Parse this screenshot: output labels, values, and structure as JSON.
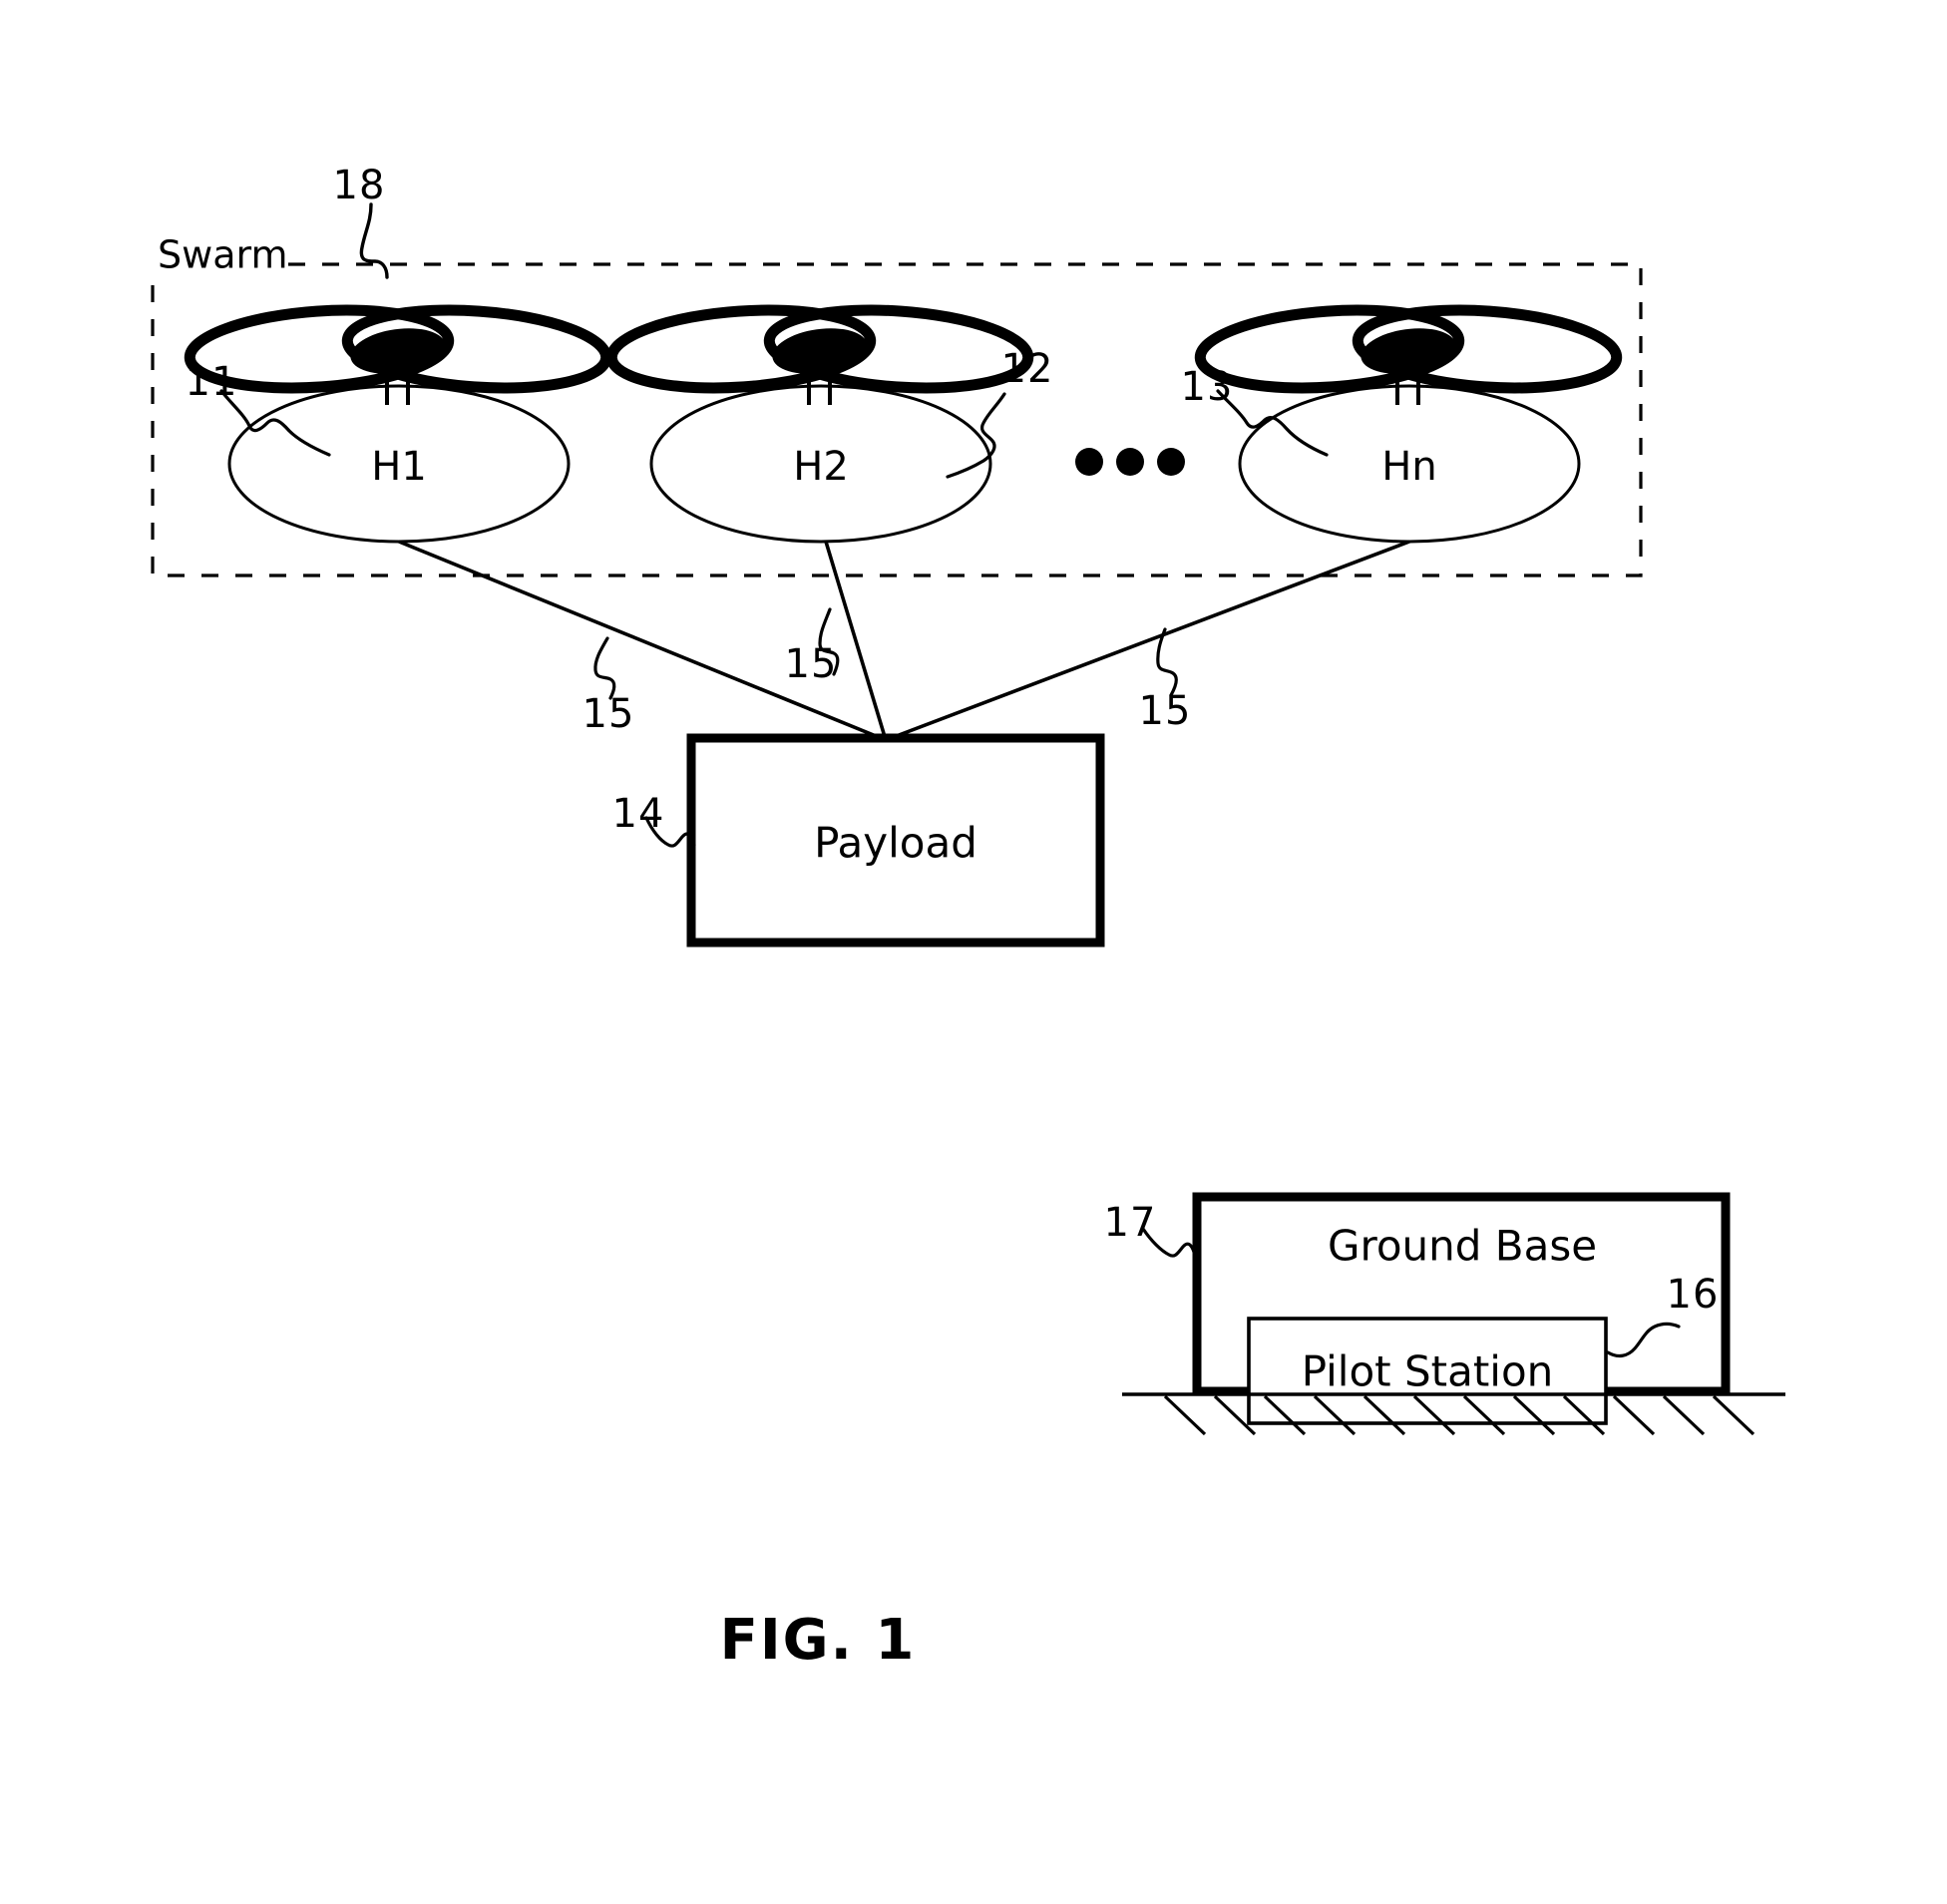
{
  "figure": {
    "caption": "FIG. 1",
    "title_implicit": "Swarm of tethered helicopters carrying a payload with ground base pilot station"
  },
  "swarm": {
    "label": "Swarm",
    "ref": "18",
    "drones": [
      {
        "name": "H1",
        "ref": "11"
      },
      {
        "name": "H2",
        "ref": "12"
      },
      {
        "name": "Hn",
        "ref": "13"
      }
    ],
    "ellipsis": "• • •"
  },
  "tethers": {
    "ref": "15",
    "labels": [
      "15",
      "15",
      "15"
    ]
  },
  "payload": {
    "label": "Payload",
    "ref": "14"
  },
  "ground_base": {
    "label": "Ground Base",
    "ref": "17",
    "pilot_station": {
      "label": "Pilot Station",
      "ref": "16"
    }
  },
  "colors": {
    "ink": "#000000",
    "paper": "#ffffff"
  }
}
